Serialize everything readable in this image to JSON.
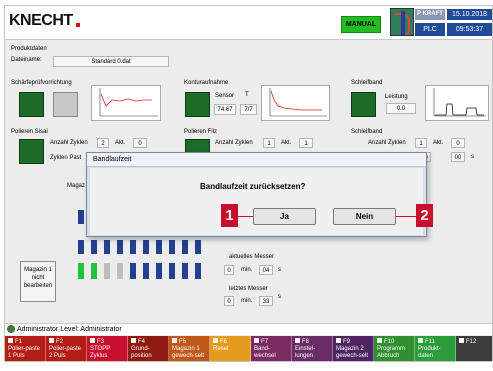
{
  "header": {
    "logo": "KNECHT",
    "mode": "MANUAL",
    "plc_top": "P KRAFT",
    "plc": "PLC",
    "date": "15.10.2018",
    "time": "09:53:37"
  },
  "produktdaten": {
    "title": "Produktdaten",
    "dateiname_label": "Dateiname:",
    "dateiname_value": "Standard 0.dat"
  },
  "schaerfe": {
    "title": "Schärfeprüfvorrichtung"
  },
  "kontur": {
    "title": "Konturaufnahme",
    "sensor_label": "Sensor",
    "t_label": "T",
    "val1": "74.67",
    "val2": "7/7"
  },
  "schleifband1": {
    "title": "Schleifband",
    "leistung_label": "Leistung",
    "leistung_value": "0.0"
  },
  "sisal": {
    "title": "Polieren Sisal",
    "zyklen_label": "Anzahl Zyklen",
    "zyklen_value": "2",
    "akt_label": "Akt.",
    "akt_value": "0",
    "past_label": "Zyklen Past"
  },
  "filz": {
    "title": "Polieren Filz",
    "zyklen_label": "Anzahl Zyklen",
    "zyklen_value": "1",
    "akt_label": "Akt.",
    "akt_value": "1"
  },
  "schleifband2": {
    "title": "Schleifband",
    "zyklen_label": "Anzahl Zyklen",
    "zyklen_value": "1",
    "akt_label": "Akt.",
    "akt_value": "0",
    "min_value": "0",
    "sec_value": "00",
    "s_label": "s"
  },
  "magazin": {
    "label_partial": "Magaz",
    "button": "Magazin 1 nicht bearbeiten",
    "slot_status": [
      "green",
      "green",
      "gray",
      "gray",
      "blue",
      "blue",
      "blue",
      "blue",
      "blue",
      "blue"
    ]
  },
  "messer": {
    "aktuelles_label": "aktuelles Messer",
    "aktuelles_min": "0",
    "aktuelles_sec": "04",
    "letztes_label": "letztes Messer",
    "letztes_min": "0",
    "letztes_sec": "33",
    "min_label": "min.",
    "s_label": "s"
  },
  "dialog": {
    "title": "Bandlaufzeit",
    "question": "Bandlaufzeit zurücksetzen?",
    "yes": "Ja",
    "no": "Nein"
  },
  "callouts": {
    "one": "1",
    "two": "2"
  },
  "status": {
    "user": "Administrator",
    "level": "Level: Administrator"
  },
  "fkeys": [
    {
      "key": "F1",
      "label": "Polier-paste 1 Puls",
      "color": "#b31d16"
    },
    {
      "key": "F2",
      "label": "Polier-paste 2 Puls",
      "color": "#b31d16"
    },
    {
      "key": "F3",
      "label": "STOPP Zyklus",
      "color": "#c8102e"
    },
    {
      "key": "F4",
      "label": "Grund-position",
      "color": "#8f1a12"
    },
    {
      "key": "F5",
      "label": "Magazin 1 gewech-selt",
      "color": "#c0571a"
    },
    {
      "key": "F6",
      "label": "Reset",
      "color": "#e59b1e"
    },
    {
      "key": "F7",
      "label": "Band-wechsel",
      "color": "#7c2a62"
    },
    {
      "key": "F8",
      "label": "Einstel-lungen",
      "color": "#6a2c66"
    },
    {
      "key": "F9",
      "label": "Magazin 2 gewech-selt",
      "color": "#4e2462"
    },
    {
      "key": "F10",
      "label": "Programm Abbruch",
      "color": "#2f8f2f"
    },
    {
      "key": "F11",
      "label": "Produkt-daten",
      "color": "#2a9c3a"
    },
    {
      "key": "F12",
      "label": "",
      "color": "#3c3c3c"
    }
  ]
}
